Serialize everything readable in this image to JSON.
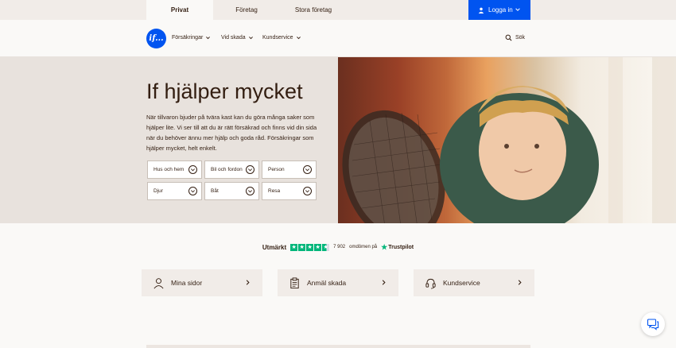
{
  "top_tabs": [
    "Privat",
    "Företag",
    "Stora företag"
  ],
  "login": {
    "label": "Logga in"
  },
  "logo": {
    "text": "if..."
  },
  "nav": {
    "items": [
      "Försäkringar",
      "Vid skada",
      "Kundservice"
    ],
    "search_label": "Sök"
  },
  "hero": {
    "title": "If hjälper mycket",
    "text": "När tillvaron bjuder på tvära kast kan du göra många saker som hjälper lite. Vi ser till att du är rätt försäkrad och finns vid din sida när du behöver ännu mer hjälp och goda råd. Försäkringar som hjälper mycket, helt enkelt.",
    "pickers": [
      "Hus och hem",
      "Bil och fordon",
      "Person",
      "Djur",
      "Båt",
      "Resa"
    ]
  },
  "trustpilot": {
    "lead": "Utmärkt",
    "rating_stars": 4.5,
    "reviews": "7 902",
    "reviews_suffix": "omdömen på",
    "brand": "Trustpilot"
  },
  "cards": [
    {
      "label": "Mina sidor",
      "icon": "person-icon"
    },
    {
      "label": "Anmäl skada",
      "icon": "clipboard-icon"
    },
    {
      "label": "Kundservice",
      "icon": "headset-icon"
    }
  ],
  "colors": {
    "accent": "#0054f0",
    "text": "#331e11",
    "hero_bg": "#e8e2dd",
    "trust_green": "#00b67a"
  }
}
